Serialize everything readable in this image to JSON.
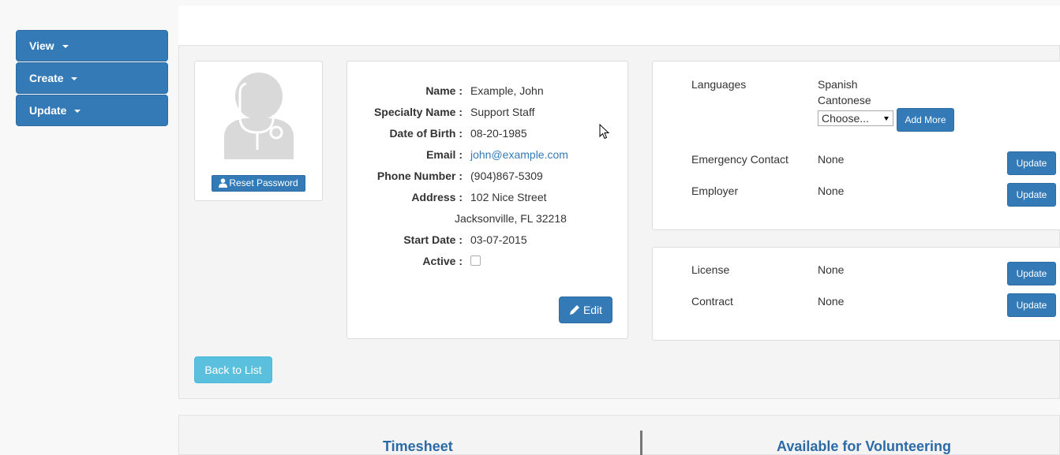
{
  "sidebar": {
    "items": [
      {
        "label": "View"
      },
      {
        "label": "Create"
      },
      {
        "label": "Update"
      }
    ]
  },
  "profile": {
    "avatar_icon": "doctor-avatar-icon",
    "reset_password_label": "Reset Password",
    "fields": {
      "name": {
        "label": "Name :",
        "value": "Example, John"
      },
      "specialty": {
        "label": "Specialty Name :",
        "value": "Support Staff"
      },
      "dob": {
        "label": "Date of Birth :",
        "value": "08-20-1985"
      },
      "email": {
        "label": "Email :",
        "value": "john@example.com"
      },
      "phone": {
        "label": "Phone Number :",
        "value": "(904)867-5309"
      },
      "address": {
        "label": "Address :",
        "line1": "102 Nice Street",
        "line2": "Jacksonville, FL 32218"
      },
      "start_date": {
        "label": "Start Date :",
        "value": "03-07-2015"
      },
      "active": {
        "label": "Active :",
        "checked": false
      }
    },
    "edit_label": "Edit"
  },
  "details": {
    "languages": {
      "label": "Languages",
      "values": [
        "Spanish",
        "Cantonese"
      ],
      "select_value": "Choose...",
      "add_more_label": "Add More"
    },
    "emergency_contact": {
      "label": "Emergency Contact",
      "value": "None",
      "button": "Update"
    },
    "employer": {
      "label": "Employer",
      "value": "None",
      "button": "Update"
    },
    "license": {
      "label": "License",
      "value": "None",
      "button": "Update"
    },
    "contract": {
      "label": "Contract",
      "value": "None",
      "button": "Update"
    }
  },
  "back_to_list_label": "Back to List",
  "bottom": {
    "timesheet_title": "Timesheet",
    "volunteer_title": "Available for Volunteering"
  },
  "colors": {
    "primary": "#337ab7",
    "info": "#5bc0de",
    "heading": "#2c6aa6"
  }
}
